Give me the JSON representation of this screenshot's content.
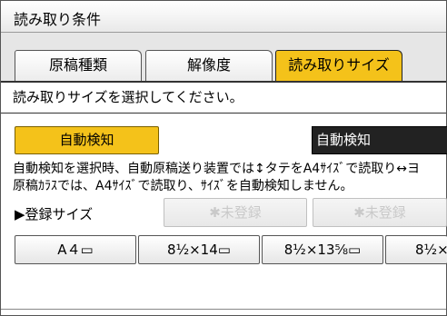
{
  "window": {
    "title": "読み取り条件"
  },
  "tabs": [
    {
      "label": "原稿種類",
      "active": false
    },
    {
      "label": "解像度",
      "active": false
    },
    {
      "label": "読み取りサイズ",
      "active": true
    }
  ],
  "instruction": "読み取りサイズを選択してください。",
  "auto_detect": {
    "button_label": "自動検知",
    "current_value": "自動検知"
  },
  "notes": [
    "自動検知を選択時、自動原稿送り装置では↕タテをA4ｻｲｽﾞで読取り↔ヨ",
    "原稿ｶﾗｽでは、A4ｻｲｽﾞで読取り、ｻｲｽﾞを自動検知しません。"
  ],
  "registered_sizes": {
    "label": "▶登録サイズ",
    "buttons": [
      "✱未登録",
      "✱未登録"
    ]
  },
  "size_buttons": [
    "A４▭",
    "8½×14▭",
    "8½×13⅝▭",
    "8½×"
  ],
  "colors": {
    "accent": "#f4c21a",
    "display_bg": "#222222"
  }
}
